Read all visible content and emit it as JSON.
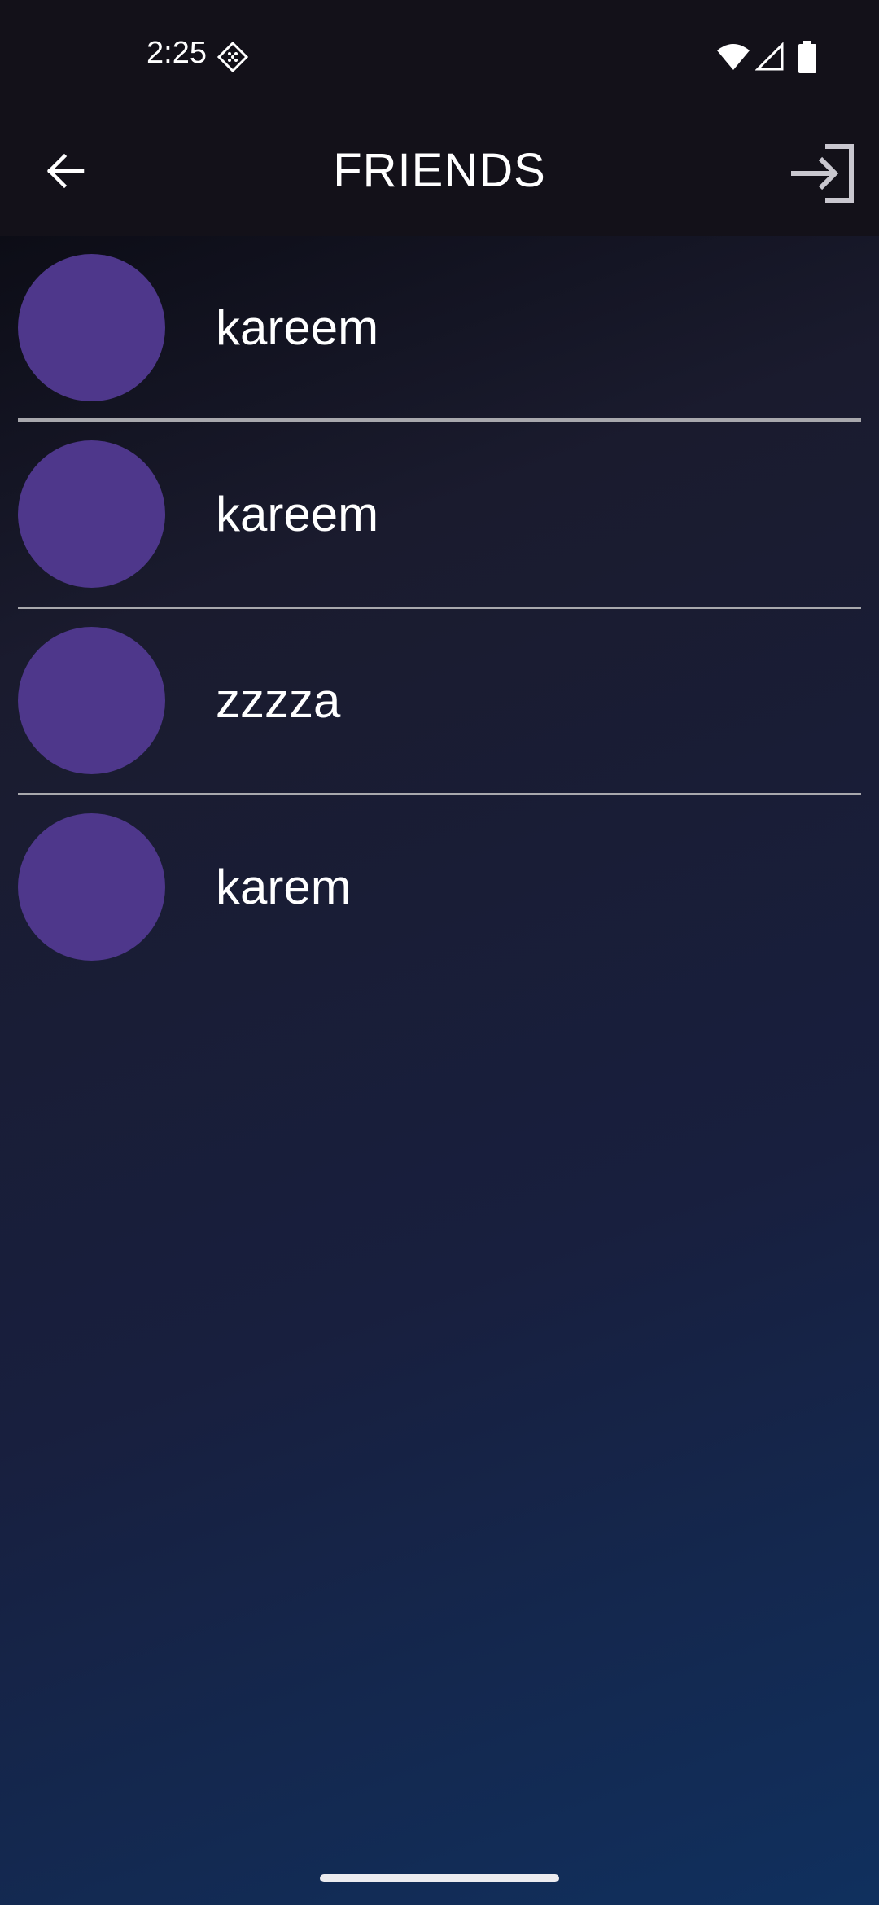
{
  "status_bar": {
    "time": "2:25",
    "app_icon": "notification-app-icon",
    "icons": [
      "wifi-icon",
      "cell-signal-icon",
      "battery-icon"
    ]
  },
  "app_bar": {
    "title": "FRIENDS",
    "back_icon": "arrow-left-icon",
    "action_icon": "login-icon"
  },
  "friends": [
    {
      "name": "kareem"
    },
    {
      "name": "kareem"
    },
    {
      "name": "zzzza"
    },
    {
      "name": "karem"
    }
  ],
  "colors": {
    "bar_background": "#131119",
    "avatar": "#4e378b",
    "divider": "#a8a8ad",
    "text": "#ffffff"
  }
}
